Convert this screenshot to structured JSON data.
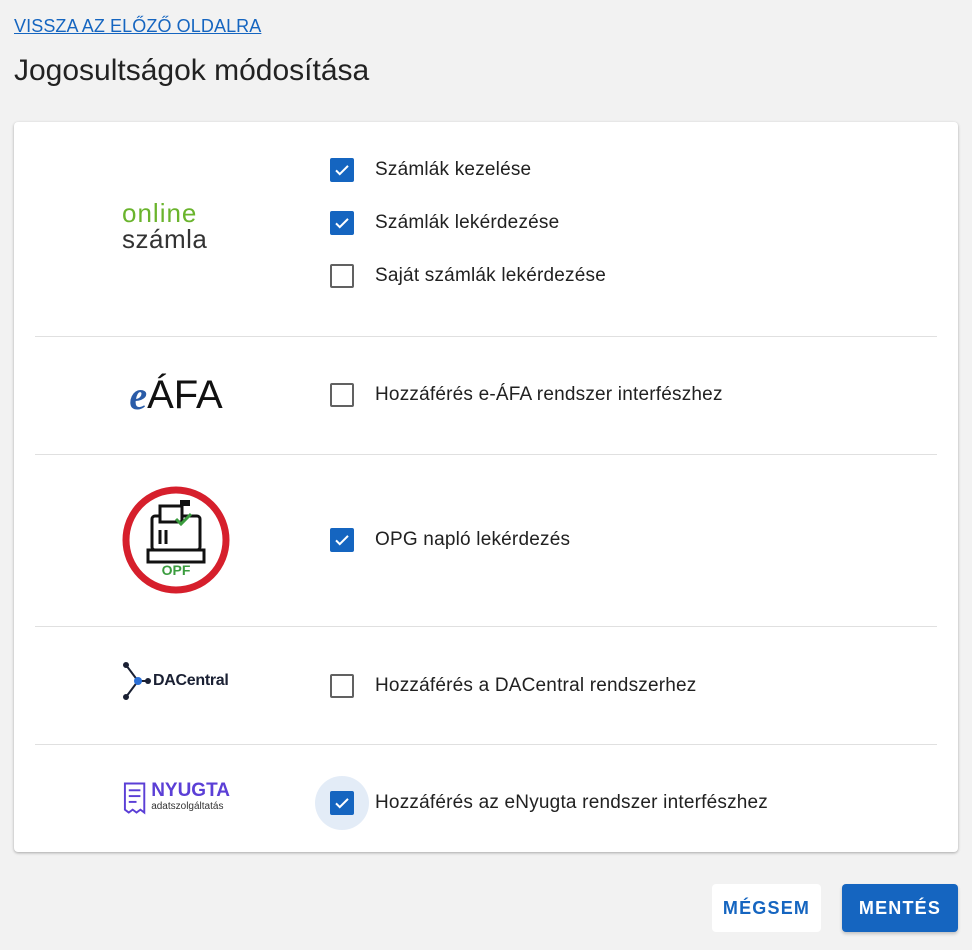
{
  "nav": {
    "back_label": "VISSZA AZ ELŐZŐ OLDALRA"
  },
  "page": {
    "title": "Jogosultságok módosítása"
  },
  "colors": {
    "accent": "#1565c0",
    "opf_red": "#d61f2c",
    "opf_green": "#3a9c3e",
    "online_green": "#6ab42d",
    "eafa_blue": "#2a5ca8",
    "nyugta_purple": "#5b3fd6"
  },
  "sections": [
    {
      "logo": {
        "line1": "online",
        "line2": "számla"
      },
      "permissions": [
        {
          "label": "Számlák kezelése",
          "checked": true
        },
        {
          "label": "Számlák lekérdezése",
          "checked": true
        },
        {
          "label": "Saját számlák lekérdezése",
          "checked": false
        }
      ]
    },
    {
      "logo": {
        "prefix": "e",
        "text": "ÁFA"
      },
      "permissions": [
        {
          "label": "Hozzáférés e-ÁFA rendszer interfészhez",
          "checked": false
        }
      ]
    },
    {
      "logo": {
        "text": "OPF"
      },
      "permissions": [
        {
          "label": "OPG napló lekérdezés",
          "checked": true
        }
      ]
    },
    {
      "logo": {
        "text": "DACentral"
      },
      "permissions": [
        {
          "label": "Hozzáférés a DACentral rendszerhez",
          "checked": false
        }
      ]
    },
    {
      "logo": {
        "text": "NYUGTA",
        "sub": "adatszolgáltatás"
      },
      "permissions": [
        {
          "label": "Hozzáférés az eNyugta rendszer interfészhez",
          "checked": true,
          "focused": true
        }
      ]
    }
  ],
  "actions": {
    "cancel_label": "MÉGSEM",
    "save_label": "MENTÉS"
  }
}
